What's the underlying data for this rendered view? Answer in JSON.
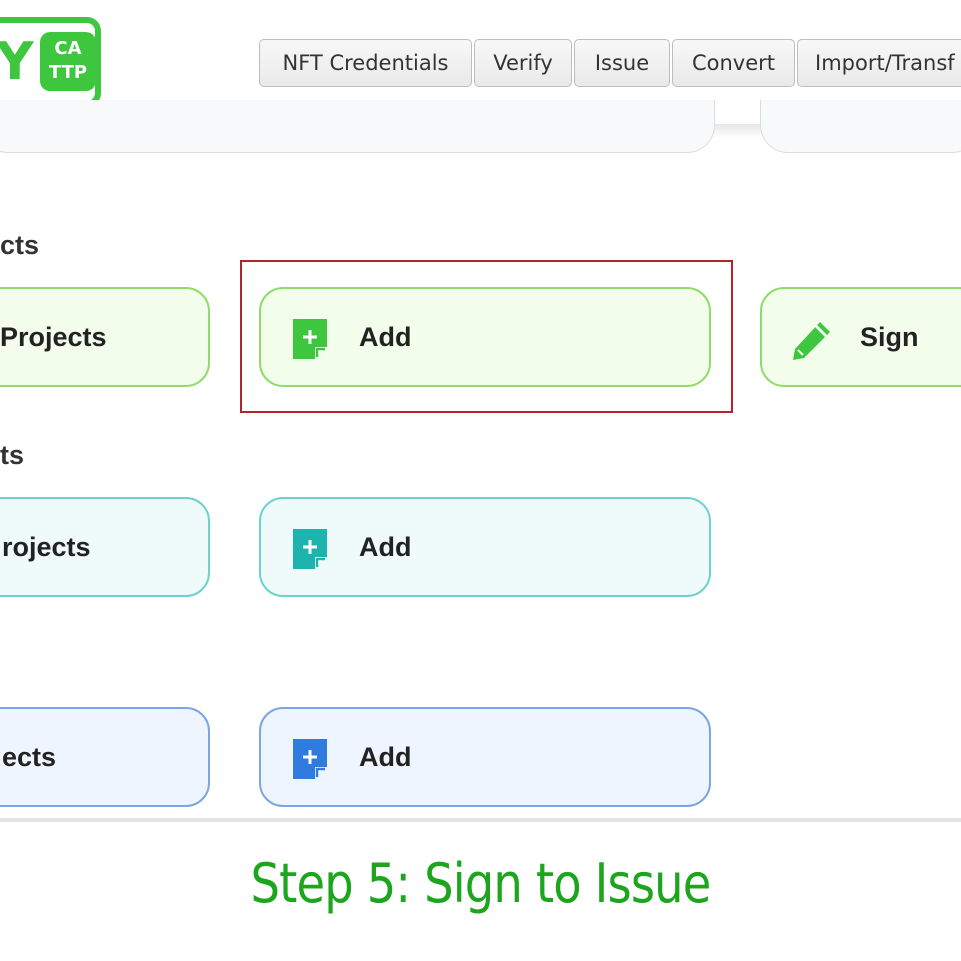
{
  "logo": {
    "letter": "Y",
    "badge_line1": "CA",
    "badge_line2": "TTP"
  },
  "nav": {
    "tabs": [
      {
        "label": "NFT Credentials"
      },
      {
        "label": "Verify"
      },
      {
        "label": "Issue"
      },
      {
        "label": "Convert"
      },
      {
        "label": "Import/Transf"
      }
    ]
  },
  "sections": [
    {
      "title": "cts",
      "cards": [
        {
          "label": "Projects"
        },
        {
          "label": "Add",
          "icon": "add-document-icon"
        },
        {
          "label": "Sign",
          "icon": "pencil-icon"
        }
      ]
    },
    {
      "title": "ts",
      "cards": [
        {
          "label": "rojects"
        },
        {
          "label": "Add",
          "icon": "add-document-icon"
        }
      ]
    },
    {
      "title": "",
      "cards": [
        {
          "label": "ects"
        },
        {
          "label": "Add",
          "icon": "add-document-icon"
        }
      ]
    }
  ],
  "colors": {
    "green": "#3fc63f",
    "teal": "#1fb3b0",
    "blue": "#2f7be0",
    "highlight": "#b3252b",
    "caption": "#1da51d"
  },
  "caption": {
    "text": "Step 5: Sign to Issue"
  }
}
